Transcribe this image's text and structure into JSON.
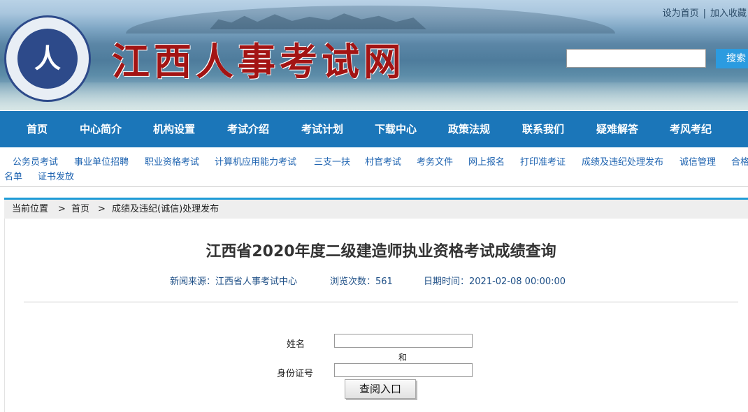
{
  "header": {
    "site_title": "江西人事考试网",
    "logo_text": "人",
    "top_links": [
      "设为首页",
      "加入收藏"
    ],
    "top_links_sep": "|",
    "search_placeholder": "",
    "search_button": "搜索"
  },
  "nav": {
    "items": [
      "首页",
      "中心简介",
      "机构设置",
      "考试介绍",
      "考试计划",
      "下载中心",
      "政策法规",
      "联系我们",
      "疑难解答",
      "考风考纪"
    ]
  },
  "subnav": {
    "items": [
      "公务员考试",
      "事业单位招聘",
      "职业资格考试",
      "计算机应用能力考试",
      "三支一扶",
      "村官考试",
      "考务文件",
      "网上报名",
      "打印准考证",
      "成绩及违纪处理发布",
      "诚信管理",
      "合格",
      "名单",
      "证书发放"
    ]
  },
  "breadcrumb": {
    "label": "当前位置",
    "sep": ">",
    "home": "首页",
    "current": "成绩及违纪(诚信)处理发布"
  },
  "article": {
    "title": "江西省2020年度二级建造师执业资格考试成绩查询",
    "source": "新闻来源：江西省人事考试中心",
    "views": "浏览次数：561",
    "date": "日期时间：2021-02-08 00:00:00"
  },
  "form": {
    "name_label": "姓名",
    "name_value": "",
    "and_text": "和",
    "id_label": "身份证号",
    "id_value": "",
    "submit_label": "查阅入口"
  }
}
